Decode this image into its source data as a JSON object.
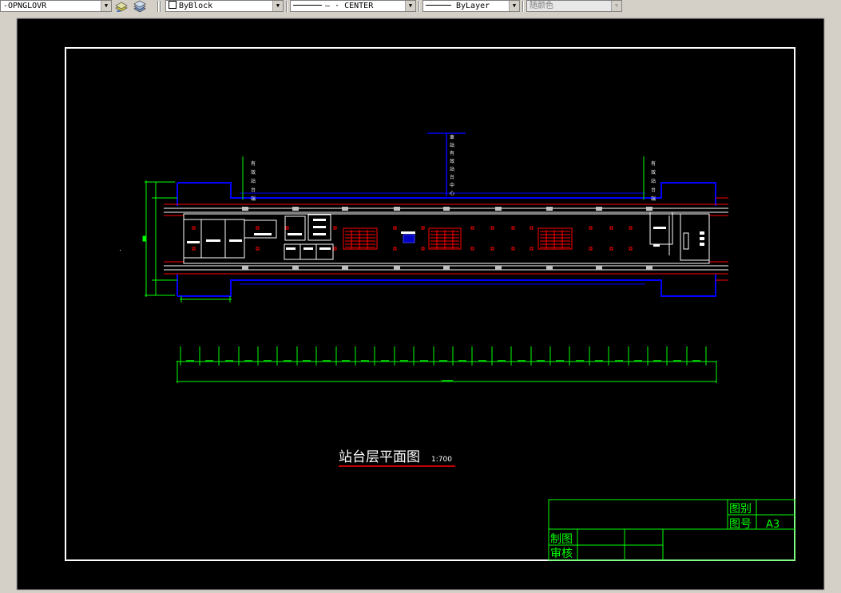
{
  "toolbar": {
    "layer_value": "-OPNGLOVR",
    "color_value": "ByBlock",
    "linetype_value": "CENTER",
    "lineweight_value": "ByLayer",
    "plotstyle_value": "随颜色"
  },
  "drawing": {
    "title": "站台层平面图",
    "scale": "1:700",
    "left_label_chars": [
      "有",
      "效",
      "站",
      "台",
      "端"
    ],
    "center_label_chars": [
      "車",
      "站",
      "有",
      "效",
      "站",
      "台",
      "中",
      "心"
    ],
    "right_label_chars": [
      "有",
      "效",
      "站",
      "台",
      "端"
    ],
    "title_block": {
      "tu_bie": "图别",
      "tu_hao": "图号",
      "sheet_size": "A3",
      "zhi_tu": "制图",
      "shen_he": "审核"
    }
  },
  "colors": {
    "canvas_bg": "#000000",
    "border": "#ffffff",
    "dimension": "#00ff00",
    "wall": "#0000ff",
    "escalator": "#ff0000",
    "title_block": "#00ff00"
  }
}
